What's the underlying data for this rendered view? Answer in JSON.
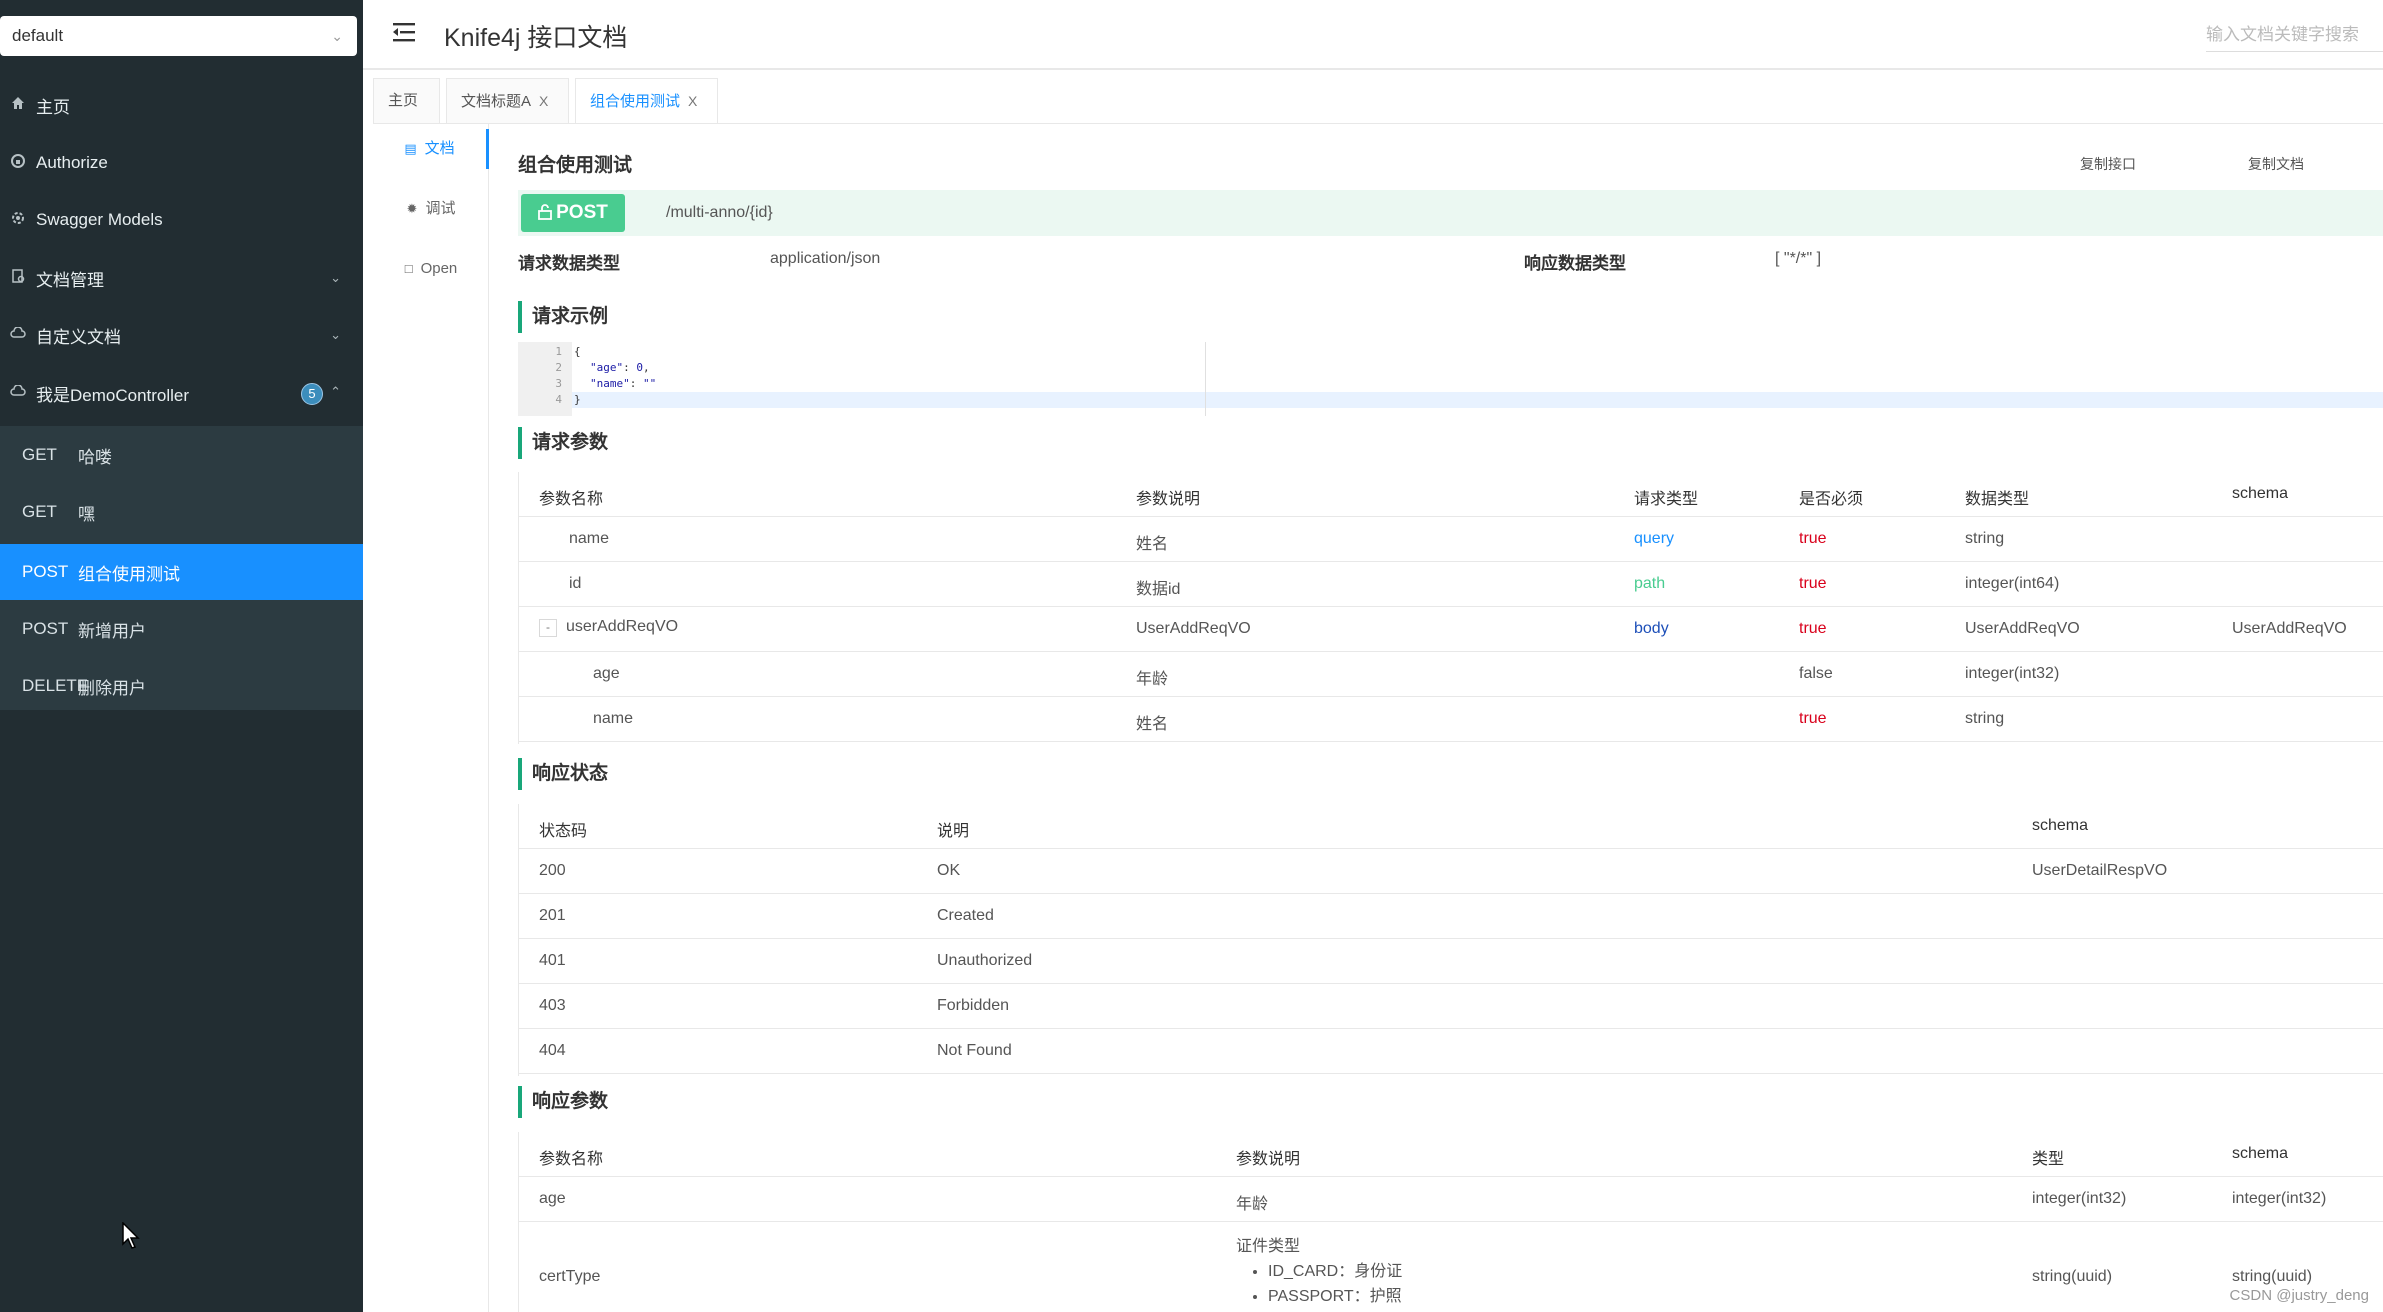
{
  "sidebar": {
    "group_select": "default",
    "items": [
      {
        "icon": "home-icon",
        "label": "主页"
      },
      {
        "icon": "lock-icon",
        "label": "Authorize"
      },
      {
        "icon": "settings-icon",
        "label": "Swagger Models"
      },
      {
        "icon": "doc-manage-icon",
        "label": "文档管理"
      },
      {
        "icon": "cloud-icon",
        "label": "自定义文档"
      },
      {
        "icon": "cloud-icon",
        "label": "我是DemoController",
        "badge": "5"
      }
    ],
    "apis": [
      {
        "method": "GET",
        "label": "哈喽"
      },
      {
        "method": "GET",
        "label": "嘿"
      },
      {
        "method": "POST",
        "label": "组合使用测试",
        "active": true
      },
      {
        "method": "POST",
        "label": "新增用户"
      },
      {
        "method": "DELETE",
        "label": "删除用户"
      }
    ]
  },
  "header": {
    "title": "Knife4j 接口文档",
    "search_placeholder": "输入文档关键字搜索"
  },
  "tabs": [
    {
      "label": "主页"
    },
    {
      "label": "文档标题A",
      "close": "X"
    },
    {
      "label": "组合使用测试",
      "close": "X",
      "active": true
    }
  ],
  "docnav": [
    {
      "label": "文档",
      "active": true
    },
    {
      "label": "调试"
    },
    {
      "label": "Open"
    }
  ],
  "api": {
    "title": "组合使用测试",
    "copy_api": "复制接口",
    "copy_doc": "复制文档",
    "method": "POST",
    "path": "/multi-anno/{id}",
    "req_type_label": "请求数据类型",
    "req_type_value": "application/json",
    "resp_type_label": "响应数据类型",
    "resp_type_value": "[ \"*/*\" ]"
  },
  "request_example": {
    "title": "请求示例",
    "lines": [
      "1",
      "2",
      "3",
      "4"
    ],
    "code": {
      "open": "{",
      "age_key": "\"age\"",
      "age_val": "0",
      "name_key": "\"name\"",
      "name_val": "\"\"",
      "close": "}"
    }
  },
  "request_params": {
    "title": "请求参数",
    "headers": [
      "参数名称",
      "参数说明",
      "请求类型",
      "是否必须",
      "数据类型",
      "schema"
    ],
    "rows": [
      {
        "name": "name",
        "desc": "姓名",
        "in": "query",
        "required": "true",
        "type": "string",
        "schema": ""
      },
      {
        "name": "id",
        "desc": "数据id",
        "in": "path",
        "required": "true",
        "type": "integer(int64)",
        "schema": ""
      },
      {
        "name": "userAddReqVO",
        "desc": "UserAddReqVO",
        "in": "body",
        "required": "true",
        "type": "UserAddReqVO",
        "schema": "UserAddReqVO",
        "expander": "-"
      },
      {
        "name": "age",
        "desc": "年龄",
        "in": "",
        "required": "false",
        "type": "integer(int32)",
        "schema": ""
      },
      {
        "name": "name",
        "desc": "姓名",
        "in": "",
        "required": "true",
        "type": "string",
        "schema": ""
      }
    ]
  },
  "response_status": {
    "title": "响应状态",
    "headers": [
      "状态码",
      "说明",
      "schema"
    ],
    "rows": [
      {
        "code": "200",
        "desc": "OK",
        "schema": "UserDetailRespVO"
      },
      {
        "code": "201",
        "desc": "Created",
        "schema": ""
      },
      {
        "code": "401",
        "desc": "Unauthorized",
        "schema": ""
      },
      {
        "code": "403",
        "desc": "Forbidden",
        "schema": ""
      },
      {
        "code": "404",
        "desc": "Not Found",
        "schema": ""
      }
    ]
  },
  "response_params": {
    "title": "响应参数",
    "headers": [
      "参数名称",
      "参数说明",
      "类型",
      "schema"
    ],
    "rows": [
      {
        "name": "age",
        "desc": "年龄",
        "type": "integer(int32)",
        "schema": "integer(int32)"
      },
      {
        "name": "certType",
        "desc": "证件类型",
        "enum": [
          "ID_CARD：身份证",
          "PASSPORT：护照"
        ],
        "type": "string(uuid)",
        "schema": "string(uuid)"
      }
    ]
  },
  "watermark": "CSDN @justry_deng",
  "colors": {
    "sidebar_bg": "#222d32",
    "active_blue": "#1890ff",
    "post_green": "#49cc90",
    "required_red": "#d9001b"
  }
}
